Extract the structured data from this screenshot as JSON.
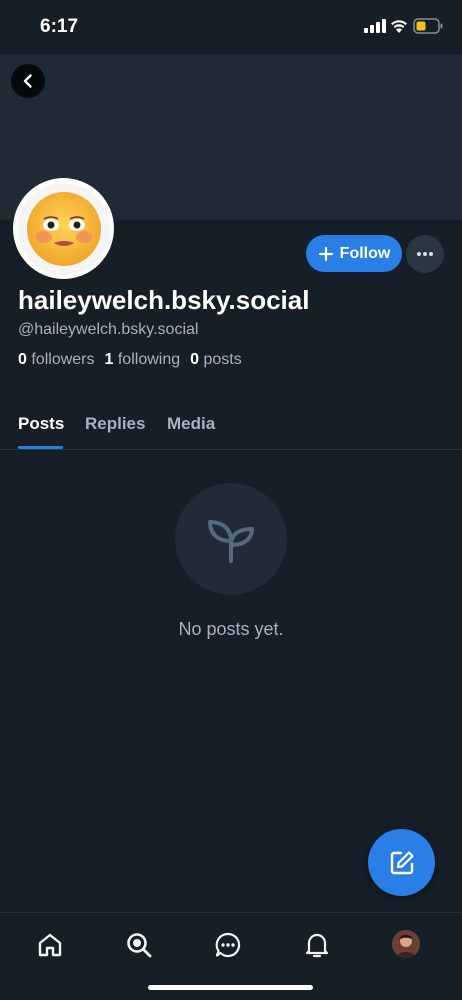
{
  "status_bar": {
    "time": "6:17"
  },
  "profile": {
    "display_name": "haileywelch.bsky.social",
    "handle": "@haileywelch.bsky.social",
    "followers_count": "0",
    "followers_label": "followers",
    "following_count": "1",
    "following_label": "following",
    "posts_count": "0",
    "posts_label": "posts"
  },
  "actions": {
    "follow_label": "Follow"
  },
  "tabs": [
    {
      "label": "Posts",
      "active": true
    },
    {
      "label": "Replies",
      "active": false
    },
    {
      "label": "Media",
      "active": false
    }
  ],
  "empty_state": {
    "message": "No posts yet.",
    "icon": "seedling-icon"
  },
  "bottom_nav": {
    "items": [
      "home-icon",
      "search-icon",
      "chat-icon",
      "bell-icon",
      "profile-avatar"
    ]
  },
  "colors": {
    "background": "#161e27",
    "banner": "#1f2a35",
    "accent": "#2a7fe6",
    "muted_text": "#a7b2bd"
  }
}
